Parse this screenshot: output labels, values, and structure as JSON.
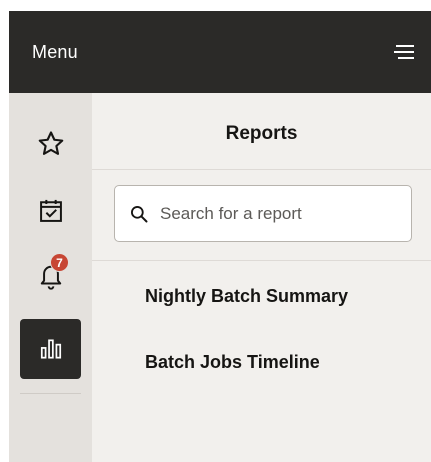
{
  "header": {
    "menu_label": "Menu"
  },
  "rail": {
    "items": [
      {
        "icon": "star-icon",
        "label": ""
      },
      {
        "icon": "calendar-check-icon",
        "label": ""
      },
      {
        "icon": "bell-icon",
        "badge": "7"
      },
      {
        "icon": "bar-chart-icon",
        "active": true
      }
    ]
  },
  "panel": {
    "title": "Reports",
    "search": {
      "placeholder": "Search for a report",
      "value": ""
    },
    "reports": [
      {
        "label": "Nightly Batch Summary"
      },
      {
        "label": "Batch Jobs Timeline"
      }
    ]
  },
  "colors": {
    "header_bg": "#2b2a28",
    "rail_bg": "#e4e1dd",
    "panel_bg": "#f2f0ed",
    "badge_bg": "#c74634"
  }
}
